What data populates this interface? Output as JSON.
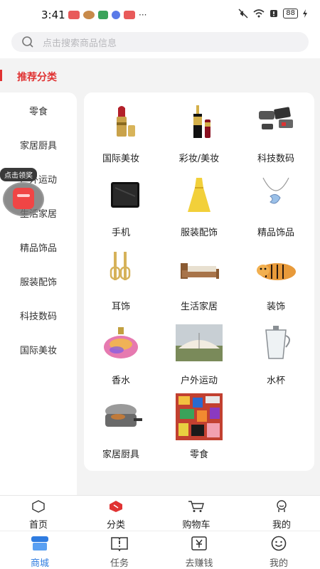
{
  "status_bar": {
    "time": "3:41",
    "dots": "···",
    "battery": "88"
  },
  "search": {
    "placeholder": "点击搜索商品信息"
  },
  "section": {
    "title": "推荐分类"
  },
  "sidebar": {
    "items": [
      {
        "label": "零食"
      },
      {
        "label": "家居厨具"
      },
      {
        "label": "户外运动"
      },
      {
        "label": "生活家居"
      },
      {
        "label": "精品饰品"
      },
      {
        "label": "服装配饰"
      },
      {
        "label": "科技数码"
      },
      {
        "label": "国际美妆"
      }
    ]
  },
  "reward": {
    "tag": "点击领奖"
  },
  "grid": {
    "items": [
      {
        "label": "国际美妆",
        "icon": "lipstick-icon"
      },
      {
        "label": "彩妆/美妆",
        "icon": "makeup-icon"
      },
      {
        "label": "科技数码",
        "icon": "gadgets-icon"
      },
      {
        "label": "手机",
        "icon": "phone-icon"
      },
      {
        "label": "服装配饰",
        "icon": "dress-icon"
      },
      {
        "label": "精品饰品",
        "icon": "necklace-icon"
      },
      {
        "label": "耳饰",
        "icon": "earring-icon"
      },
      {
        "label": "生活家居",
        "icon": "bed-icon"
      },
      {
        "label": "装饰",
        "icon": "tiger-plush-icon"
      },
      {
        "label": "香水",
        "icon": "perfume-icon"
      },
      {
        "label": "户外运动",
        "icon": "tent-icon"
      },
      {
        "label": "水杯",
        "icon": "glass-cup-icon"
      },
      {
        "label": "家居厨具",
        "icon": "waffle-maker-icon"
      },
      {
        "label": "零食",
        "icon": "snacks-icon"
      }
    ]
  },
  "tabbar_top": {
    "items": [
      {
        "label": "首页",
        "icon": "home-cube-icon"
      },
      {
        "label": "分类",
        "icon": "category-icon"
      },
      {
        "label": "购物车",
        "icon": "cart-icon"
      },
      {
        "label": "我的",
        "icon": "user-icon"
      }
    ]
  },
  "tabbar_bottom": {
    "items": [
      {
        "label": "商城",
        "icon": "mall-icon"
      },
      {
        "label": "任务",
        "icon": "task-book-icon"
      },
      {
        "label": "去赚钱",
        "icon": "yen-icon"
      },
      {
        "label": "我的",
        "icon": "smile-icon"
      }
    ]
  },
  "colors": {
    "accent_red": "#e03232",
    "active_blue": "#2f7ce0"
  }
}
